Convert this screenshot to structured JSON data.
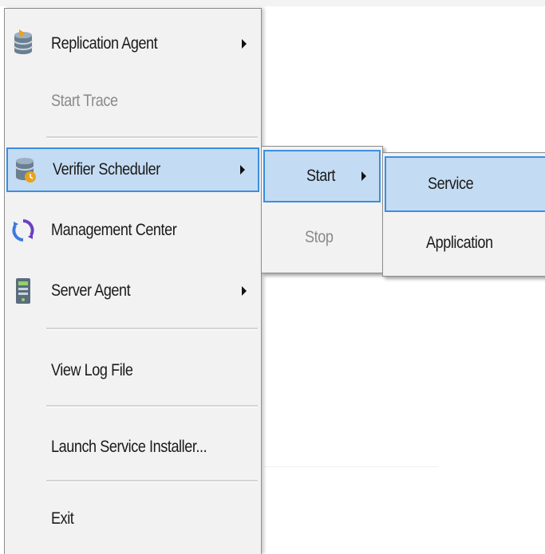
{
  "main_menu": {
    "items": [
      {
        "label": "Replication Agent",
        "icon": "database-arrow-icon",
        "submenu": true,
        "disabled": false
      },
      {
        "label": "Start Trace",
        "disabled": true
      },
      {
        "label": "Verifier Scheduler",
        "icon": "database-clock-icon",
        "submenu": true,
        "selected": true
      },
      {
        "label": "Management Center",
        "icon": "refresh-circle-icon"
      },
      {
        "label": "Server Agent",
        "icon": "server-icon",
        "submenu": true
      },
      {
        "label": "View Log File"
      },
      {
        "label": "Launch Service Installer..."
      },
      {
        "label": "Exit"
      }
    ]
  },
  "verifier_submenu": {
    "items": [
      {
        "label": "Start",
        "submenu": true,
        "selected": true
      },
      {
        "label": "Stop",
        "disabled": true
      }
    ]
  },
  "start_submenu": {
    "items": [
      {
        "label": "Service",
        "selected": true
      },
      {
        "label": "Application"
      }
    ]
  },
  "colors": {
    "menu_background": "#f2f2f2",
    "selection_fill": "#c4dcf3",
    "selection_border": "#3b8ee0",
    "disabled_text": "#8a8a8a"
  }
}
